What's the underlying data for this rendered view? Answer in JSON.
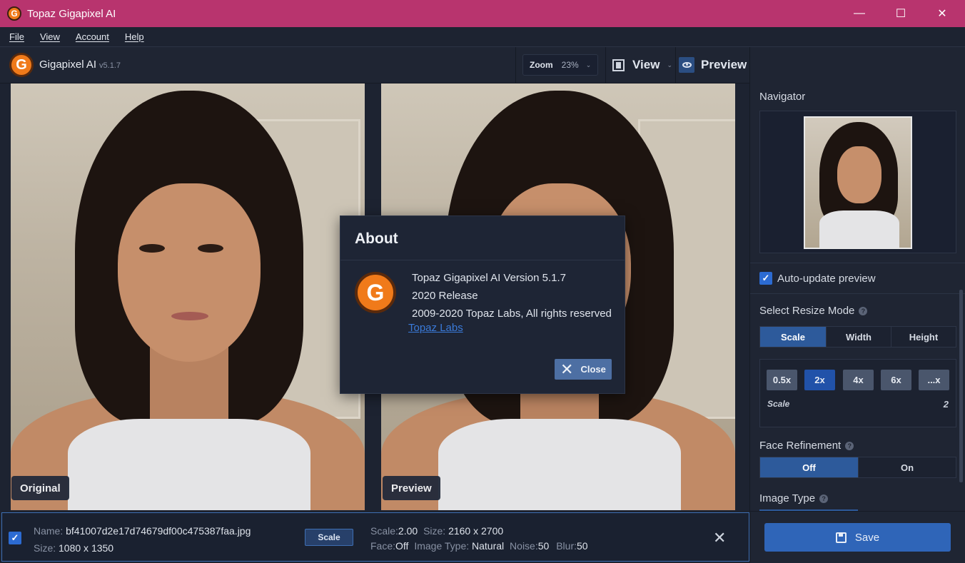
{
  "window": {
    "title": "Topaz Gigapixel AI",
    "controls": {
      "minimize": "—",
      "maximize": "☐",
      "close": "✕"
    }
  },
  "menu": [
    "File",
    "View",
    "Account",
    "Help"
  ],
  "toolbar": {
    "app_name": "Gigapixel AI",
    "version": "v5.1.7",
    "zoom_label": "Zoom",
    "zoom_value": "23%",
    "view_label": "View",
    "preview_label": "Preview"
  },
  "panes": {
    "original_label": "Original",
    "preview_label": "Preview"
  },
  "file_bar": {
    "checked": true,
    "name_label": "Name:",
    "name_value": "bf41007d2e17d74679df00c475387faa.jpg",
    "size_label": "Size:",
    "size_value": "1080 x 1350",
    "mode_pill": "Scale",
    "scale_label": "Scale:",
    "scale_value": "2.00",
    "out_size_label": "Size:",
    "out_size_value": "2160 x 2700",
    "face_label": "Face:",
    "face_value": "Off",
    "image_type_label": "Image Type:",
    "image_type_value": "Natural",
    "noise_label": "Noise:",
    "noise_value": "50",
    "blur_label": "Blur:",
    "blur_value": "50"
  },
  "sidebar": {
    "navigator_title": "Navigator",
    "auto_update_label": "Auto-update preview",
    "auto_update_checked": true,
    "resize_mode_title": "Select Resize Mode",
    "resize_modes": [
      "Scale",
      "Width",
      "Height"
    ],
    "resize_mode_active": "Scale",
    "scale_options": [
      "0.5x",
      "2x",
      "4x",
      "6x",
      "...x"
    ],
    "scale_active": "2x",
    "scale_label": "Scale",
    "scale_value": "2",
    "face_refinement_title": "Face Refinement",
    "face_options": [
      "Off",
      "On"
    ],
    "face_active": "Off",
    "image_type_title": "Image Type",
    "help_glyph": "?",
    "save_label": "Save"
  },
  "about_dialog": {
    "title": "About",
    "line1": "Topaz Gigapixel AI Version 5.1.7",
    "line2": "2020 Release",
    "line3": "2009-2020 Topaz Labs, All rights reserved",
    "link": "Topaz Labs",
    "close_label": "Close"
  },
  "icons": {
    "app_logo_letter": "G",
    "check_glyph": "✓",
    "close_glyph": "✕",
    "chevron_glyph": "⌄"
  },
  "colors": {
    "titlebar": "#b8346e",
    "accent": "#2f65b8",
    "logo_orange": "#f07a1a",
    "panel_bg": "#1f2533"
  }
}
